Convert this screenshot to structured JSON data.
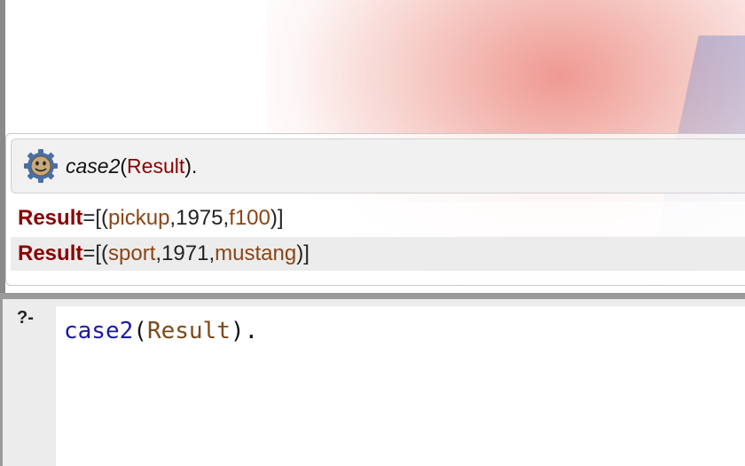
{
  "query": {
    "predicate": "case2",
    "open_paren": "(",
    "variable": "Result",
    "close": ")."
  },
  "results": [
    {
      "variable": "Result",
      "equals": " = ",
      "prefix": "[(",
      "atom1": "pickup",
      "sep1": ",",
      "number": "1975",
      "sep2": ",",
      "atom2": "f100",
      "suffix": ")]"
    },
    {
      "variable": "Result",
      "equals": " = ",
      "prefix": "[(",
      "atom1": "sport",
      "sep1": ",",
      "number": "1971",
      "sep2": ",",
      "atom2": "mustang",
      "suffix": ")]"
    }
  ],
  "prompt": {
    "label": "?-"
  },
  "editor": {
    "predicate": "case2",
    "open_paren": "(",
    "variable": "Result",
    "close": ")."
  },
  "icons": {
    "query_icon": "gear-smiley-icon"
  },
  "colors": {
    "variable": "#8b0000",
    "atom": "#8b4513",
    "editor_predicate": "#1a1aa6"
  }
}
